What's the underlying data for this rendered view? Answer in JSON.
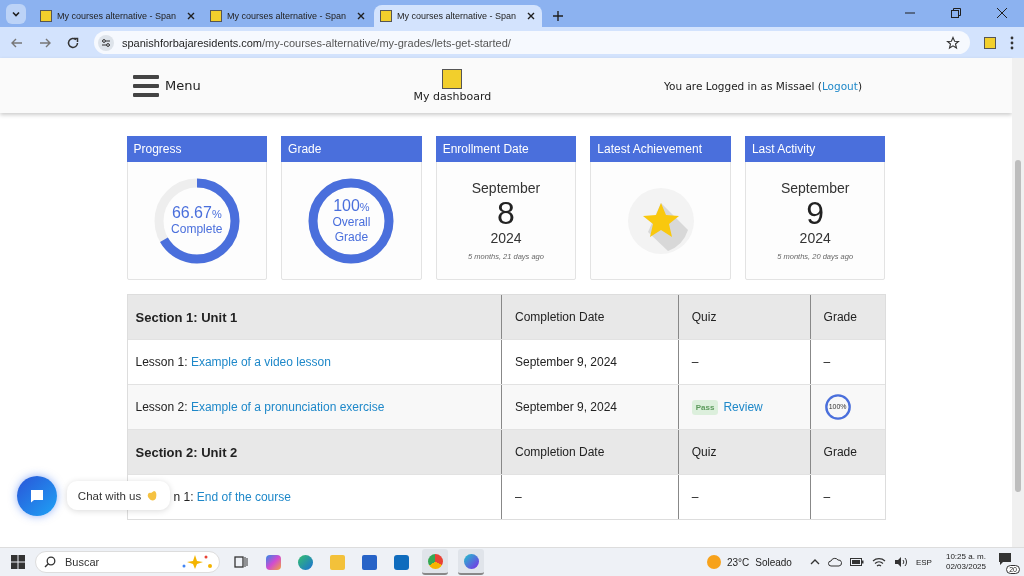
{
  "browser": {
    "tabs": [
      {
        "title": "My courses alternative - Span",
        "selected": false
      },
      {
        "title": "My courses alternative - Span",
        "selected": false
      },
      {
        "title": "My courses alternative - Span",
        "selected": true
      }
    ],
    "address": {
      "domain": "spanishforbajaresidents.com",
      "path": "/my-courses-alternative/my-grades/lets-get-started/"
    }
  },
  "header": {
    "menu_label": "Menu",
    "logo_label": "My dashboard",
    "login_text": "You are Logged in as Missael (",
    "logout": "Logout",
    "login_end": ")"
  },
  "cards": [
    {
      "kind": "ring",
      "title": "Progress",
      "value": "66.67",
      "unit": "%",
      "caption": "Complete",
      "level": 0.6667
    },
    {
      "kind": "ring",
      "title": "Grade",
      "value": "100",
      "unit": "%",
      "caption": "Overall Grade",
      "level": 1
    },
    {
      "kind": "date",
      "title": "Enrollment Date",
      "month": "September",
      "day": "8",
      "year": "2024",
      "ago": "5 months, 21 days ago"
    },
    {
      "kind": "star",
      "title": "Latest Achievement"
    },
    {
      "kind": "date",
      "title": "Last Activity",
      "month": "September",
      "day": "9",
      "year": "2024",
      "ago": "5 months, 20 days ago"
    }
  ],
  "sections": [
    {
      "title": "Section 1: Unit 1",
      "columns": [
        "Completion Date",
        "Quiz",
        "Grade"
      ],
      "lessons": [
        {
          "prefix": "Lesson 1: ",
          "link": "Example of a video lesson",
          "date": "September 9, 2024",
          "quiz": {
            "kind": "dash",
            "text": "–"
          },
          "grade": {
            "kind": "dash",
            "text": "–"
          }
        },
        {
          "prefix": "Lesson 2: ",
          "link": "Example of a pronunciation exercise",
          "date": "September 9, 2024",
          "quiz": {
            "kind": "pass",
            "badge": "Pass",
            "link": "Review"
          },
          "grade": {
            "kind": "ring",
            "text": "100%",
            "level": 1
          }
        }
      ]
    },
    {
      "title": "Section 2: Unit 2",
      "columns": [
        "Completion Date",
        "Quiz",
        "Grade"
      ],
      "lessons": [
        {
          "prefix": "n 1: ",
          "link": "End of the course",
          "date": "–",
          "quiz": {
            "kind": "dash",
            "text": "–"
          },
          "grade": {
            "kind": "dash",
            "text": "–"
          }
        }
      ]
    }
  ],
  "chat": {
    "label": "Chat with us"
  },
  "taskbar": {
    "search_placeholder": "Buscar",
    "temperature": "23°C",
    "weather": "Soleado",
    "language": "ESP",
    "time": "10:25 a. m.",
    "date": "02/03/2025",
    "notifications": "20"
  }
}
